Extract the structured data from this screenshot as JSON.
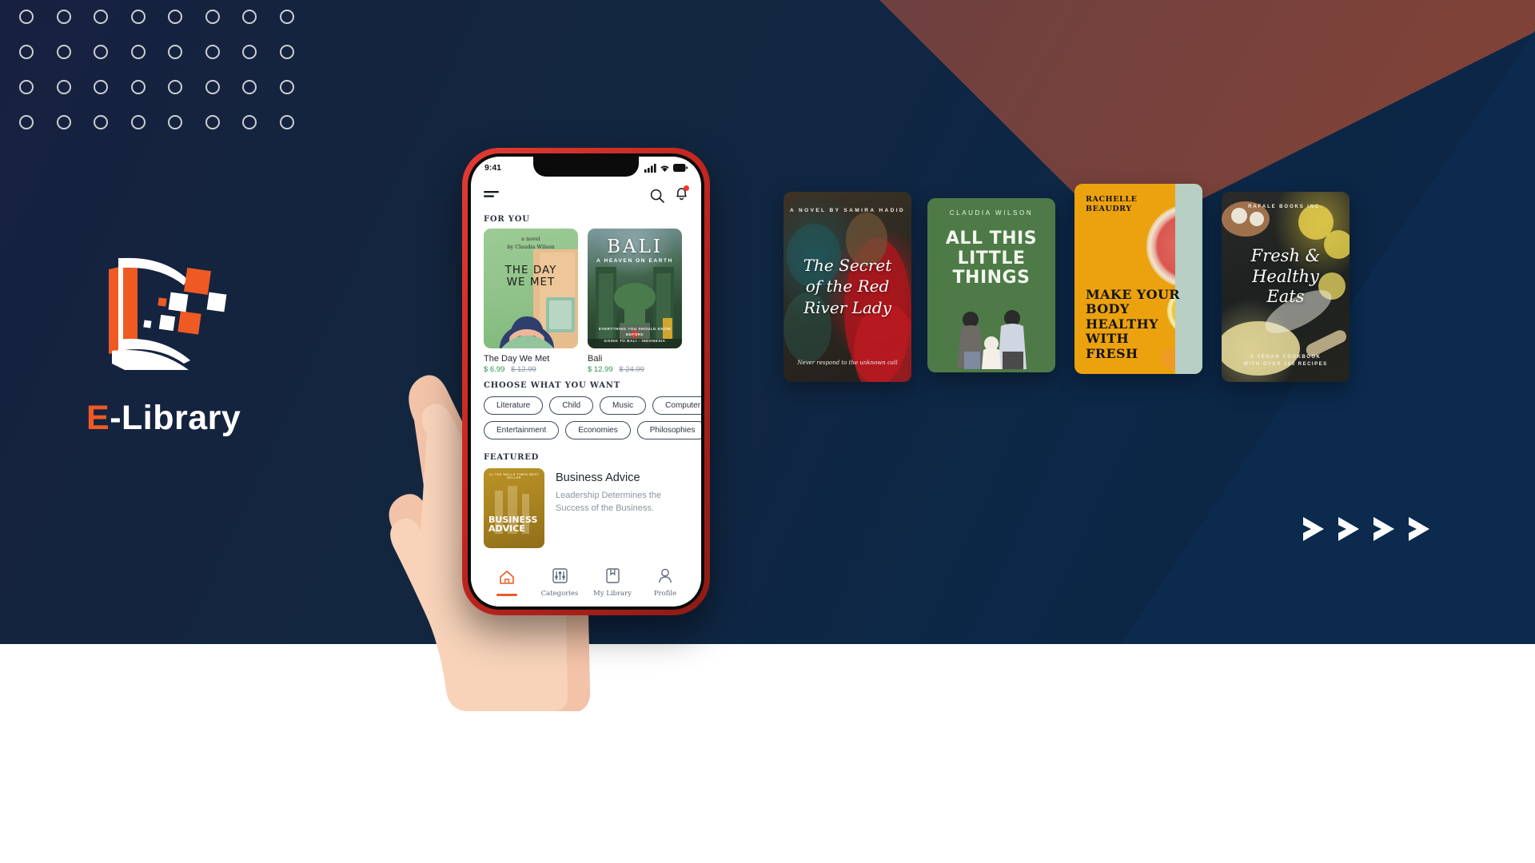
{
  "brand": {
    "name_accent": "E",
    "name_rest": "-Library",
    "logo_icon": "open-book-logo"
  },
  "theme": {
    "navy": "#0b2a4d",
    "navy_dark": "#16213f",
    "maroon": "#6d4040",
    "orange": "#ef5a23",
    "white": "#ffffff"
  },
  "phone": {
    "status_bar": {
      "time": "9:41",
      "signal_icon": "cellular-bars-icon",
      "wifi_icon": "wifi-icon",
      "battery_icon": "battery-icon"
    },
    "app_bar": {
      "menu_icon": "hamburger-menu-icon",
      "search_icon": "search-icon",
      "notifications_icon": "bell-icon",
      "notification_badge": true
    },
    "for_you": {
      "label": "FOR YOU",
      "books": [
        {
          "title": "The Day We Met",
          "price": "$ 6.99",
          "old_price": "$ 12.99",
          "cover_byline": "a novel",
          "cover_author": "by Claudia Wilson",
          "cover_title": "THE DAY\nWE MET",
          "cover_art": "illustrated-woman-green-room"
        },
        {
          "title": "Bali",
          "price": "$ 12.99",
          "old_price": "$ 24.99",
          "cover_title": "BALI",
          "cover_subtitle": "A HEAVEN ON EARTH",
          "cover_footer": "EVERYTHING YOU SHOULD KNOW BEFORE GOING TO BALI - INDONESIA",
          "cover_art": "bali-temple-gate-photo"
        }
      ]
    },
    "categories": {
      "label": "CHOOSE WHAT YOU WANT",
      "row_one": [
        "Literature",
        "Child",
        "Music",
        "Computer"
      ],
      "row_two": [
        "Entertainment",
        "Economies",
        "Philosophies"
      ]
    },
    "featured": {
      "label": "FEATURED",
      "item": {
        "title": "Business Advice",
        "description": "Leadership Determines the Success of the Business.",
        "cover_top": "#1 THE WALLS TIMES BEST SELLER",
        "cover_title": "BUSINESS ADVICE"
      }
    },
    "tab_bar": [
      {
        "label": "Home",
        "icon": "home-icon",
        "active": true
      },
      {
        "label": "Categories",
        "icon": "sliders-icon",
        "active": false
      },
      {
        "label": "My Library",
        "icon": "bookmark-book-icon",
        "active": false
      },
      {
        "label": "Profile",
        "icon": "person-icon",
        "active": false
      }
    ]
  },
  "showcase_covers": [
    {
      "id": "secret-red-river-lady",
      "author": "A NOVEL BY SAMIRA HADID",
      "title": "The Secret\nof the Red\nRiver Lady",
      "tagline": "Never respond to the unknown call",
      "art": "woman-in-red-dress-photo"
    },
    {
      "id": "all-this-little-things",
      "author": "CLAUDIA WILSON",
      "title": "ALL THIS\nLITTLE\nTHINGS",
      "art": "illustrated-family-of-three",
      "color": "#4d7a46"
    },
    {
      "id": "make-your-body-healthy",
      "author": "RACHELLE\nBEAUDRY",
      "title": "MAKE YOUR\nBODY\nHEALTHY\nWITH\nFRESH",
      "art": "grapefruit-lemon-citrus-photo",
      "color": "#eca20f"
    },
    {
      "id": "fresh-and-healthy-eats",
      "author": "RAFALE BOOKS INC.",
      "title": "Fresh &\nHealthy\nEats",
      "tagline": "A VEGAN COOKBOOK\nWITH OVER 100 RECIPES",
      "art": "lemons-dough-rolling-pin-photo"
    }
  ],
  "decor": {
    "dot_grid_columns": 8,
    "dot_grid_rows": 4,
    "chevron_count": 4,
    "chevron_icon": "chevron-right-icon",
    "hand_icon": "hand-holding-phone"
  }
}
